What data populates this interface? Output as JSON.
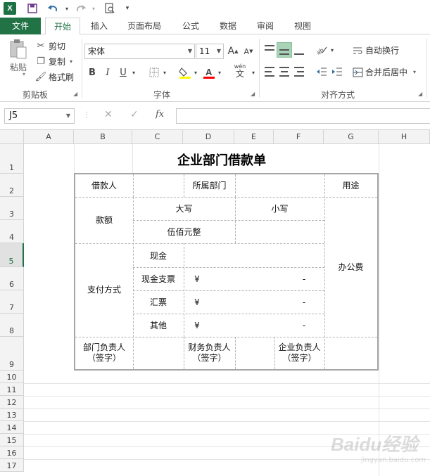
{
  "qat": {
    "app_icon": "X",
    "customize": "▾"
  },
  "tabs": [
    {
      "label": "文件"
    },
    {
      "label": "开始"
    },
    {
      "label": "插入"
    },
    {
      "label": "页面布局"
    },
    {
      "label": "公式"
    },
    {
      "label": "数据"
    },
    {
      "label": "审阅"
    },
    {
      "label": "视图"
    }
  ],
  "ribbon": {
    "clipboard": {
      "paste": "粘贴",
      "cut": "剪切",
      "copy": "复制",
      "format_painter": "格式刷",
      "label": "剪贴板"
    },
    "font": {
      "name": "宋体",
      "size": "11",
      "label": "字体",
      "bold": "B",
      "italic": "I",
      "underline": "U",
      "grow": "A",
      "shrink": "A",
      "wen": "wén"
    },
    "alignment": {
      "wrap": "自动换行",
      "merge": "合并后居中",
      "label": "对齐方式"
    }
  },
  "formula_bar": {
    "name_box": "J5",
    "fx": "fx",
    "value": ""
  },
  "columns": [
    "A",
    "B",
    "C",
    "D",
    "E",
    "F",
    "G",
    "H"
  ],
  "rows": [
    "1",
    "2",
    "3",
    "4",
    "5",
    "6",
    "7",
    "8",
    "9",
    "10",
    "11",
    "12",
    "13",
    "14",
    "15",
    "16",
    "17"
  ],
  "sheet": {
    "title": "企业部门借款单",
    "borrower": "借款人",
    "department": "所属部门",
    "purpose": "用途",
    "amount": "款额",
    "upper": "大写",
    "lower": "小写",
    "amount_text": "伍佰元整",
    "pay_method": "支付方式",
    "cash": "现金",
    "cheque": "现金支票",
    "draft": "汇票",
    "other": "其他",
    "yen": "¥",
    "dash": "-",
    "office": "办公费",
    "dept_head": "部门负责人",
    "finance_head": "财务负责人",
    "company_head": "企业负责人",
    "sign": "（签字）"
  },
  "watermark": {
    "brand": "Baidu经验",
    "url": "jingyan.baidu.com"
  }
}
